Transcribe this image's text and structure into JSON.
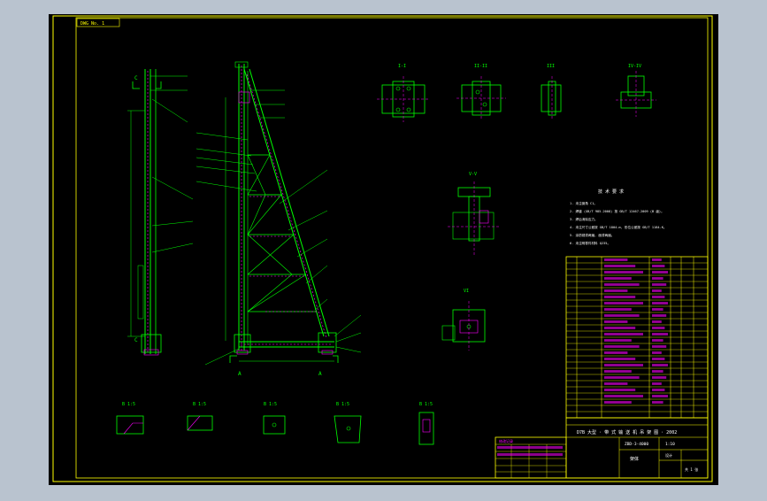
{
  "drawing": {
    "stamp_top_left": "DWG No. 1",
    "colors": {
      "background_outer": "#b9c3cf",
      "sheet": "#000000",
      "frame": "#ffff00",
      "steel": "#00ff00",
      "weld": "#ff00ff",
      "dim": "#00ffff",
      "note_text": "#ffffff",
      "leader": "#00ff00"
    },
    "views": {
      "side_view": {
        "label_top": "C",
        "label_bottom": "C"
      },
      "front_view": {
        "label_left": "A",
        "label_right": "A"
      },
      "section_labels": [
        "I-I",
        "II-II",
        "III",
        "IV-IV"
      ],
      "middle_section_labels": [
        "V-V",
        "VI"
      ],
      "detail_labels": [
        "B 1:5",
        "B 1:5",
        "B 1:5",
        "B 1:5",
        "B 1:5"
      ]
    },
    "notes": {
      "title": "技 术 要 求",
      "lines": [
        "1. 未注倒角 C1。",
        "2. 焊缝 (GB/T 985-2008) 按 GB/T 12467-2009 (B 级)。",
        "3. 焊后消除应力。",
        "4. 未注尺寸公差按 GB/T 1804-m, 形位公差按 GB/T 1184-K。",
        "5. 涂防锈漆两遍, 面漆两遍。",
        "6. 未注明零件材料 Q235。"
      ]
    },
    "title_block": {
      "main_title": "D7B 大型 · 带 式 输 送 机 吊 架 图 · 2002",
      "scale": "1:10",
      "drawing_no": "ZBD-3-4000",
      "company": "设计",
      "part_name": "架体",
      "sheet": "共 1 张"
    },
    "revision_block": {
      "title": "修改记录"
    }
  }
}
